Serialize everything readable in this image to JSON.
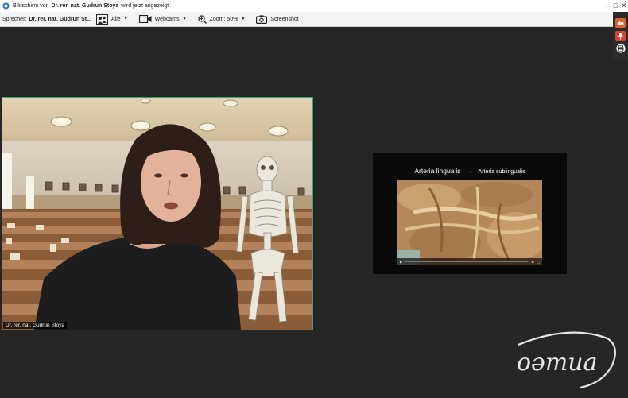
{
  "titlebar": {
    "prefix": "Bildschirm von",
    "presenter": "Dr. rer. nat. Gudrun Stoya",
    "suffix": "wird jetzt angezeigt",
    "controls": {
      "minimize": "–",
      "maximize": "□",
      "close": "✕"
    }
  },
  "toolbar": {
    "speaker_label": "Sprecher:",
    "speaker_name": "Dr. rer. nat. Gudrun St...",
    "view_all": "Alle",
    "webcams": "Webcams",
    "zoom": "Zoom: 50%",
    "screenshot": "Screenshot"
  },
  "video": {
    "name_tag": "Dr. rer. nat. Gudrun Stoya"
  },
  "slide": {
    "title": "Arteria lingualis",
    "arrow": "→",
    "subtitle": "Arteria sublingualis"
  },
  "logo": {
    "text": "oəmua"
  },
  "colors": {
    "stage_background": "#262626",
    "video_border": "#3fa56e",
    "side_orange": "#e0602b",
    "side_red": "#d9432e"
  }
}
